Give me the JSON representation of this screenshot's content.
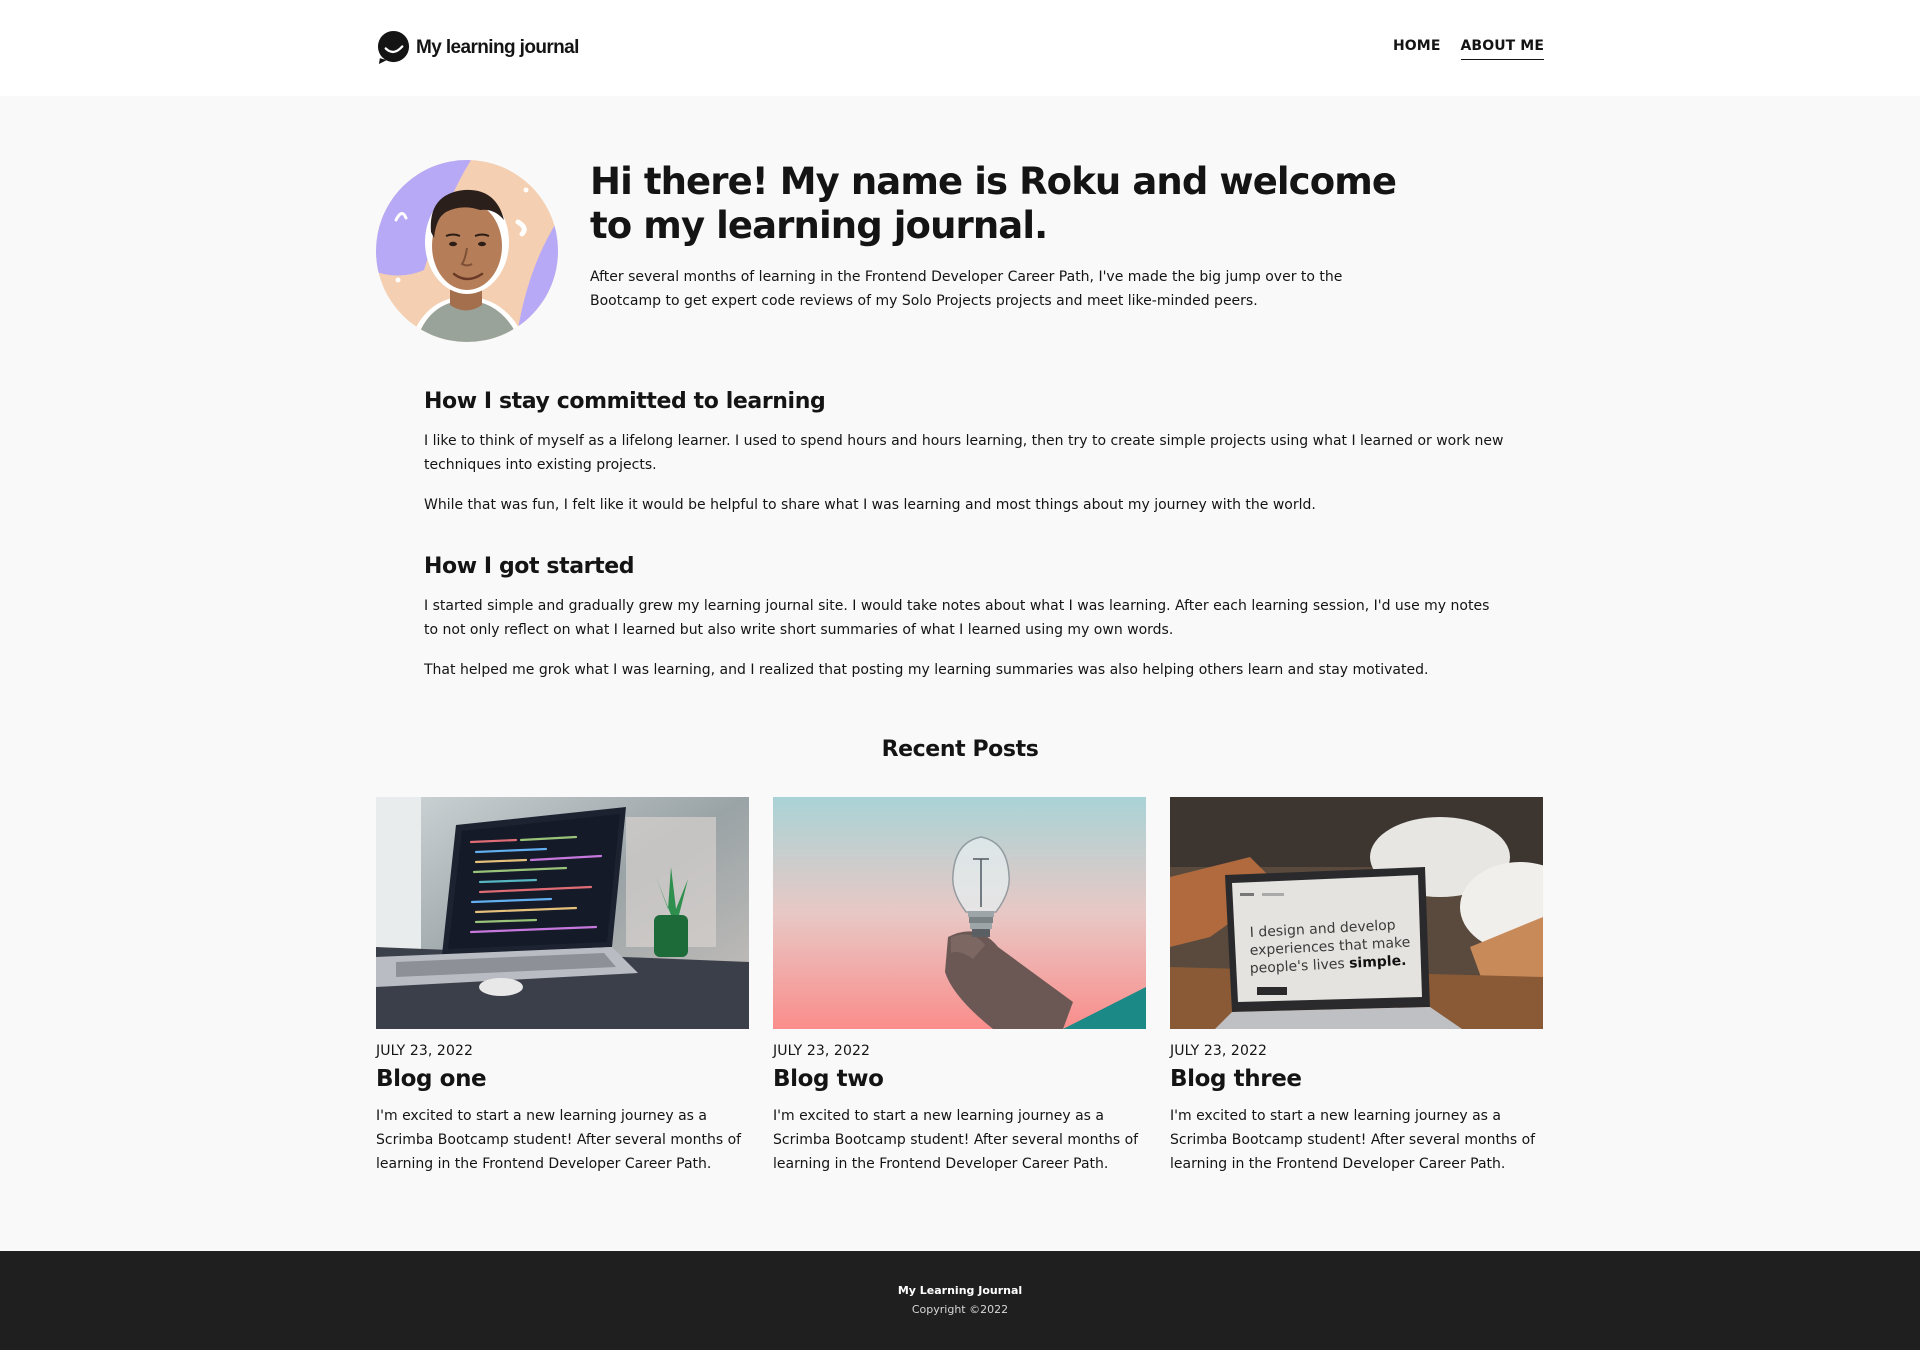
{
  "header": {
    "brand": "My learning journal",
    "nav": [
      {
        "label": "HOME",
        "active": false
      },
      {
        "label": "ABOUT ME",
        "active": true
      }
    ]
  },
  "hero": {
    "title": "Hi there! My name is Roku and welcome to my learning journal.",
    "description": "After several months of learning in the Frontend Developer Career Path, I've made the big jump over to the Bootcamp to get expert code reviews of my Solo Projects projects and meet like-minded peers."
  },
  "about": {
    "sections": [
      {
        "heading": "How I stay committed to learning",
        "paragraphs": [
          "I like to think of myself as a lifelong learner. I used to spend hours and hours learning, then try to create simple projects using what I learned or work new techniques into existing projects.",
          "While that was fun, I felt like it would be helpful to share what I was learning and most things about my journey with the world."
        ]
      },
      {
        "heading": "How I got started",
        "paragraphs": [
          "I started simple and gradually grew my learning journal site. I would take notes about what I was learning. After each learning session, I'd use my notes to not only reflect on what I learned but also write short summaries of what I learned using my own words.",
          "That helped me grok what I was learning, and I realized that posting my learning summaries was also helping others learn and stay motivated."
        ]
      }
    ]
  },
  "recent_posts": {
    "title": "Recent Posts",
    "posts": [
      {
        "date": "JULY 23, 2022",
        "title": "Blog one",
        "excerpt": "I'm excited to start a new learning journey as a Scrimba Bootcamp student! After several months of learning in the Frontend Developer Career Path.",
        "image": "laptop-with-code-photo"
      },
      {
        "date": "JULY 23, 2022",
        "title": "Blog two",
        "excerpt": "I'm excited to start a new learning journey as a Scrimba Bootcamp student! After several months of learning in the Frontend Developer Career Path.",
        "image": "hand-holding-lightbulb-photo"
      },
      {
        "date": "JULY 23, 2022",
        "title": "Blog three",
        "excerpt": "I'm excited to start a new learning journey as a Scrimba Bootcamp student! After several months of learning in the Frontend Developer Career Path.",
        "image": "laptop-portfolio-photo",
        "image_text": [
          "I design and develop",
          "experiences that make",
          "people's lives",
          "simple."
        ]
      }
    ]
  },
  "footer": {
    "brand": "My Learning Journal",
    "copyright": "Copyright ©2022"
  },
  "colors": {
    "page_bg": "#f9f9f9",
    "header_bg": "#ffffff",
    "footer_bg": "#1f1f1f",
    "text": "#141414"
  }
}
